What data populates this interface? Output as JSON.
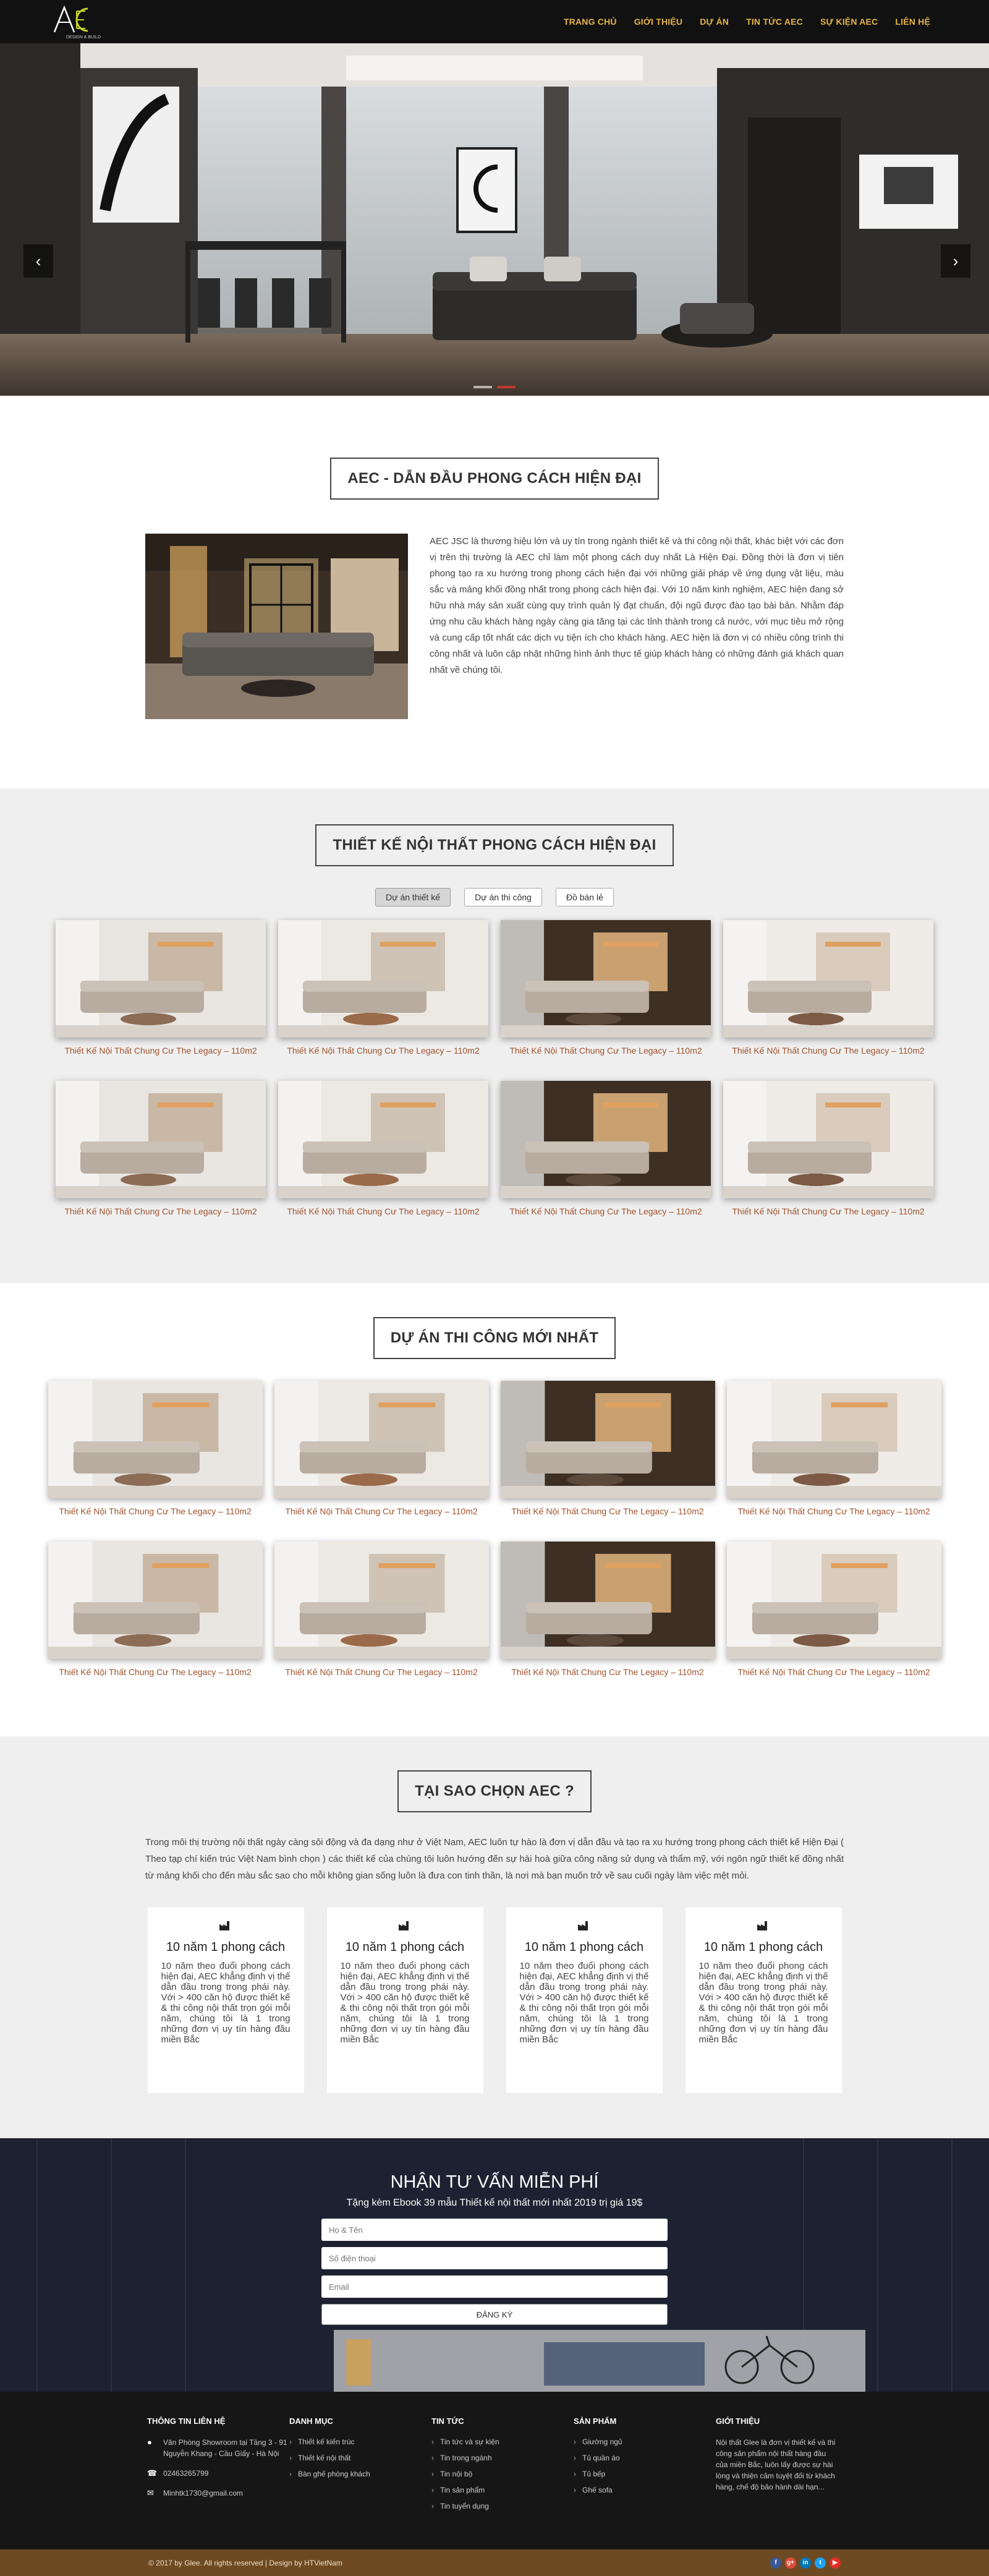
{
  "header": {
    "logo_text": "AEC",
    "logo_sub": "DESIGN & BUILD",
    "nav": [
      "TRANG CHỦ",
      "GIỚI THIỆU",
      "DỰ ÁN",
      "TIN TỨC AEC",
      "SỰ KIỆN AEC",
      "LIÊN HỆ"
    ]
  },
  "hero": {
    "prev_label": "‹",
    "next_label": "›"
  },
  "about": {
    "title": "AEC - DẪN ĐẦU PHONG CÁCH HIỆN ĐẠI",
    "text": "AEC JSC là thương hiệu lớn và uy tín trong ngành thiết kế và thi công nội thất, khác biệt với các đơn vị trên thị trường là AEC chỉ làm một phong cách duy nhất Là Hiện Đại. Đồng thời là đơn vị tiên phong tạo ra xu hướng trong phong cách hiện đại với những giải pháp về ứng dụng vật liệu, màu sắc và mảng khối đồng nhất trong phong cách hiện đại. Với 10 năm kinh nghiệm, AEC hiện đang sở hữu nhà máy sản xuất cùng quy trình quản lý đạt chuẩn, đội ngũ được đào tạo bài bản. Nhằm đáp ứng nhu cầu khách hàng ngày càng gia tăng tại các tỉnh thành trong cả nước, với mục tiêu mở rộng và cung cấp tốt nhất các dịch vụ tiện ích cho khách hàng. AEC hiện là đơn vị có nhiều công trình thi công nhất và luôn cập nhật những hình ảnh thực tế giúp khách hàng có những đánh giá khách quan nhất về chúng tôi."
  },
  "projects": {
    "title": "THIẾT KẾ NỘI THẤT PHONG CÁCH HIỆN ĐẠI",
    "tabs": [
      "Dự án thiết kế",
      "Dự án thi công",
      "Đồ bán lẻ"
    ],
    "items": [
      "Thiết Kế Nội Thất Chung Cư The Legacy – 110m2",
      "Thiết Kế Nội Thất Chung Cư The Legacy – 110m2",
      "Thiết Kế Nội Thất Chung Cư The Legacy – 110m2",
      "Thiết Kế Nội Thất Chung Cư The Legacy – 110m2",
      "Thiết Kế Nội Thất Chung Cư The Legacy – 110m2",
      "Thiết Kế Nội Thất Chung Cư The Legacy – 110m2",
      "Thiết Kế Nội Thất Chung Cư The Legacy – 110m2",
      "Thiết Kế Nội Thất Chung Cư The Legacy – 110m2"
    ]
  },
  "newest": {
    "title": "DỰ ÁN THI CÔNG MỚI NHẤT",
    "items": [
      "Thiết Kế Nội Thất Chung Cư The Legacy – 110m2",
      "Thiết Kế Nội Thất Chung Cư The Legacy – 110m2",
      "Thiết Kế Nội Thất Chung Cư The Legacy – 110m2",
      "Thiết Kế Nội Thất Chung Cư The Legacy – 110m2",
      "Thiết Kế Nội Thất Chung Cư The Legacy – 110m2",
      "Thiết Kế Nội Thất Chung Cư The Legacy – 110m2",
      "Thiết Kế Nội Thất Chung Cư The Legacy – 110m2",
      "Thiết Kế Nội Thất Chung Cư The Legacy – 110m2"
    ]
  },
  "why": {
    "title": "TẠI SAO CHỌN AEC ?",
    "text": "Trong môi thị trường nội thất ngày càng sôi động và đa dạng như ở Việt Nam, AEC luôn tự hào là đơn vị dẫn đầu và tạo ra xu hướng trong phong cách thiết kế Hiện Đại ( Theo tạp chí kiến trúc Việt Nam bình chọn ) các thiết kế của chúng tôi luôn hướng đến sự hài hoà giữa công năng sử dụng và thẩm mỹ, với ngôn ngữ thiết kế đồng nhất từ mảng khối cho đến màu sắc sao cho mỗi không gian sống luôn là đưa con tinh thần, là nơi mà bạn muốn trở về sau cuối ngày làm việc mệt mỏi.",
    "cards": [
      {
        "title": "10 năm 1 phong cách",
        "text": "10 năm theo đuổi phong cách hiện đại, AEC khẳng định vị thế dẫn đầu trong trong phái này. Với > 400 căn hộ được thiết kế & thi công nội thất trọn gói mỗi năm, chúng tôi là 1 trong những đơn vị uy tín hàng đầu miền Bắc"
      },
      {
        "title": "10 năm 1 phong cách",
        "text": "10 năm theo đuổi phong cách hiện đại, AEC khẳng định vị thế dẫn đầu trong trong phái này. Với > 400 căn hộ được thiết kế & thi công nội thất trọn gói mỗi năm, chúng tôi là 1 trong những đơn vị uy tín hàng đầu miền Bắc"
      },
      {
        "title": "10 năm 1 phong cách",
        "text": "10 năm theo đuổi phong cách hiện đại, AEC khẳng định vị thế dẫn đầu trong trong phái này. Với > 400 căn hộ được thiết kế & thi công nội thất trọn gói mỗi năm, chúng tôi là 1 trong những đơn vị uy tín hàng đầu miền Bắc"
      },
      {
        "title": "10 năm 1 phong cách",
        "text": "10 năm theo đuổi phong cách hiện đại, AEC khẳng định vị thế dẫn đầu trong trong phái này. Với > 400 căn hộ được thiết kế & thi công nội thất trọn gói mỗi năm, chúng tôi là 1 trong những đơn vị uy tín hàng đầu miền Bắc"
      }
    ]
  },
  "consult": {
    "title": "NHẬN TƯ VẤN MIỄN PHÍ",
    "subtitle": "Tặng kèm Ebook 39 mẫu Thiết kế nội thất mới nhất 2019 trị giá 19$",
    "name_placeholder": "Họ & Tên",
    "phone_placeholder": "Số điện thoại",
    "email_placeholder": "Email",
    "submit": "ĐĂNG KÝ"
  },
  "footer": {
    "contact_title": "THÔNG TIN LIÊN HỆ",
    "address": "Văn Phòng Showroom tại Tầng 3 - 91 Nguyễn Khang - Cầu Giấy - Hà Nội",
    "phone": "02463265799",
    "email": "Minhtk1730@gmail.com",
    "category_title": "DANH MỤC",
    "categories": [
      "Thiết kế kiến trúc",
      "Thiết kế nội thất",
      "Bàn ghế phòng khách"
    ],
    "news_title": "TIN TỨC",
    "news": [
      "Tin tức và sự kiện",
      "Tin trong ngành",
      "Tin nội bộ",
      "Tin sản phẩm",
      "Tin tuyển dụng"
    ],
    "products_title": "SẢN PHẨM",
    "products": [
      "Giường ngủ",
      "Tủ quần áo",
      "Tủ bếp",
      "Ghế sofa"
    ],
    "intro_title": "GIỚI THIỆU",
    "intro": "Nội thất Glee là đơn vị thiết kế và thi công sản phẩm nội thất hàng đầu của miền Bắc, luôn lấy được sự hài lòng và thiện cảm tuyệt đối từ khách hàng, chế độ bảo hành dài hạn..."
  },
  "bottom": {
    "copyright": "© 2017 by Glee. All rights reserved  |  Design by HTVietNam",
    "socials": [
      "f",
      "g+",
      "in",
      "t",
      "▶"
    ]
  },
  "colors": {
    "nav": "#e7b54a",
    "card_title": "#a0522d",
    "bottom_bar": "#6e4a23"
  }
}
